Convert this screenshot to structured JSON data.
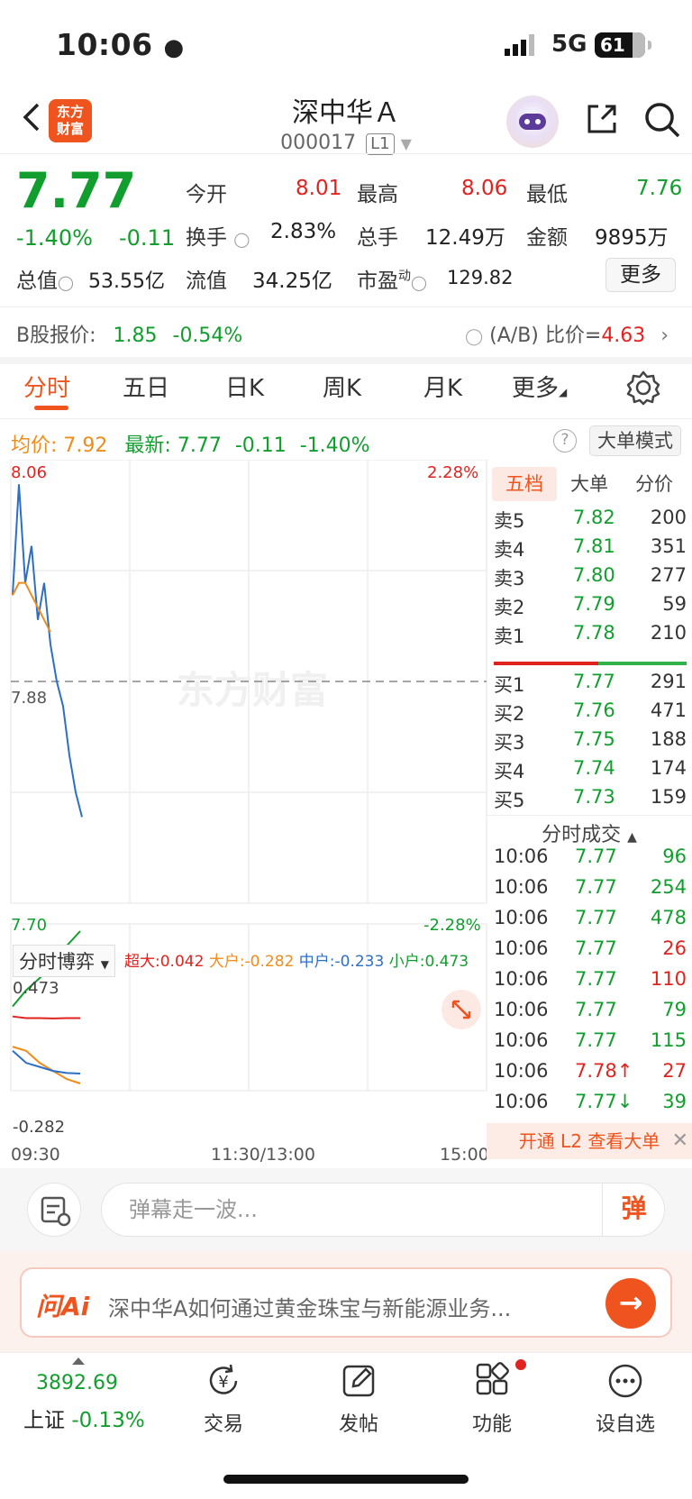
{
  "status": {
    "time": "10:06",
    "network": "5G",
    "battery": "61"
  },
  "header": {
    "logo": "东方财富",
    "stock_name": "深中华Ａ",
    "stock_code": "000017",
    "level_tag": "L1"
  },
  "quote": {
    "price": "7.77",
    "change_pct": "-1.40%",
    "change_amt": "-0.11",
    "open_label": "今开",
    "open": "8.01",
    "high_label": "最高",
    "high": "8.06",
    "low_label": "最低",
    "low": "7.76",
    "turnover_label": "换手",
    "turnover": "2.83%",
    "volume_label": "总手",
    "volume": "12.49万",
    "amount_label": "金额",
    "amount": "9895万",
    "mktcap_label": "总值",
    "mktcap": "53.55亿",
    "float_label": "流值",
    "float_cap": "34.25亿",
    "pe_label": "市盈",
    "pe_sup": "动",
    "pe": "129.82",
    "more": "更多"
  },
  "bshare": {
    "label": "B股报价:",
    "price": "1.85",
    "pct": "-0.54%",
    "ratio_label": "(A/B) 比价=",
    "ratio": "4.63"
  },
  "tabs": [
    "分时",
    "五日",
    "日K",
    "周K",
    "月K",
    "更多"
  ],
  "avg": {
    "avg_label": "均价:",
    "avg": "7.92",
    "last_label": "最新:",
    "last": "7.77",
    "chg": "-0.11",
    "pct": "-1.40%",
    "mode": "大单模式"
  },
  "chart_data": [
    {
      "type": "line",
      "title": "",
      "y_left_top": "8.06",
      "y_left_mid": "7.88",
      "y_left_bottom": "7.70",
      "y_right_top": "2.28%",
      "y_right_bottom": "-2.28%",
      "ylim": [
        7.7,
        8.06
      ],
      "prev_close": 7.88,
      "x_ticks": [
        "09:30",
        "11:30/13:00",
        "15:00"
      ],
      "watermark": "东方财富",
      "series": [
        {
          "name": "",
          "color": "#2d6fc6",
          "values": [
            7.95,
            8.04,
            7.96,
            7.99,
            7.93,
            7.96,
            7.91,
            7.88,
            7.86,
            7.82,
            7.79,
            7.77
          ]
        },
        {
          "name": "",
          "color": "#f08c1a",
          "values": [
            7.95,
            7.96,
            7.96,
            7.95,
            7.94,
            7.93,
            7.92
          ]
        }
      ]
    },
    {
      "type": "line",
      "title": "分时博弈",
      "y_top": "0.473",
      "y_bottom": "-0.282",
      "ylim": [
        -0.282,
        0.473
      ],
      "series": [
        {
          "name": "超大",
          "value": "0.042",
          "color": "#e0231f",
          "values": [
            0.05,
            0.042,
            0.042,
            0.04,
            0.042,
            0.042
          ]
        },
        {
          "name": "大户",
          "value": "-0.282",
          "color": "#f08c1a",
          "values": [
            -0.1,
            -0.12,
            -0.18,
            -0.22,
            -0.26,
            -0.282
          ]
        },
        {
          "name": "中户",
          "value": "-0.233",
          "color": "#2d6fc6",
          "values": [
            -0.12,
            -0.18,
            -0.2,
            -0.22,
            -0.23,
            -0.233
          ]
        },
        {
          "name": "小户",
          "value": "0.473",
          "color": "#129e2e",
          "values": [
            0.1,
            0.18,
            0.24,
            0.31,
            0.4,
            0.473
          ]
        }
      ]
    }
  ],
  "orderbook": {
    "tabs": [
      "五档",
      "大单",
      "分价"
    ],
    "asks": [
      {
        "label": "卖5",
        "price": "7.82",
        "vol": "200"
      },
      {
        "label": "卖4",
        "price": "7.81",
        "vol": "351"
      },
      {
        "label": "卖3",
        "price": "7.80",
        "vol": "277"
      },
      {
        "label": "卖2",
        "price": "7.79",
        "vol": "59"
      },
      {
        "label": "卖1",
        "price": "7.78",
        "vol": "210"
      }
    ],
    "bids": [
      {
        "label": "买1",
        "price": "7.77",
        "vol": "291"
      },
      {
        "label": "买2",
        "price": "7.76",
        "vol": "471"
      },
      {
        "label": "买3",
        "price": "7.75",
        "vol": "188"
      },
      {
        "label": "买4",
        "price": "7.74",
        "vol": "174"
      },
      {
        "label": "买5",
        "price": "7.73",
        "vol": "159"
      }
    ]
  },
  "ticks": {
    "title": "分时成交",
    "rows": [
      {
        "time": "10:06",
        "price": "7.77",
        "vol": "96",
        "vol_color": "#129e2e"
      },
      {
        "time": "10:06",
        "price": "7.77",
        "vol": "254",
        "vol_color": "#129e2e"
      },
      {
        "time": "10:06",
        "price": "7.77",
        "vol": "478",
        "vol_color": "#129e2e"
      },
      {
        "time": "10:06",
        "price": "7.77",
        "vol": "26",
        "vol_color": "#e0231f"
      },
      {
        "time": "10:06",
        "price": "7.77",
        "vol": "110",
        "vol_color": "#e0231f"
      },
      {
        "time": "10:06",
        "price": "7.77",
        "vol": "79",
        "vol_color": "#129e2e"
      },
      {
        "time": "10:06",
        "price": "7.77",
        "vol": "115",
        "vol_color": "#129e2e"
      },
      {
        "time": "10:06",
        "price": "7.78↑",
        "vol": "27",
        "vol_color": "#e0231f"
      },
      {
        "time": "10:06",
        "price": "7.77↓",
        "vol": "39",
        "vol_color": "#129e2e"
      }
    ],
    "l2_banner": "开通 L2 查看大单"
  },
  "comment": {
    "placeholder": "弹幕走一波...",
    "danmu": "弹"
  },
  "ai": {
    "logo": "问Ai",
    "prompt": "深中华A如何通过黄金珠宝与新能源业务..."
  },
  "bottom_nav": {
    "index_value": "3892.69",
    "index_name": "上证",
    "index_pct": "-0.13%",
    "items": [
      "交易",
      "发帖",
      "功能",
      "设自选"
    ]
  }
}
